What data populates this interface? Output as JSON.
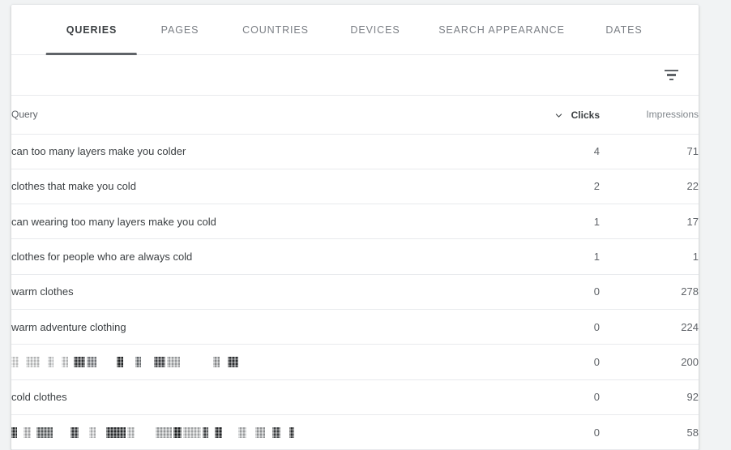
{
  "card": {
    "tabs": [
      {
        "label": "QUERIES",
        "active": true
      },
      {
        "label": "PAGES",
        "active": false
      },
      {
        "label": "COUNTRIES",
        "active": false
      },
      {
        "label": "DEVICES",
        "active": false
      },
      {
        "label": "SEARCH APPEARANCE",
        "active": false
      },
      {
        "label": "DATES",
        "active": false
      }
    ],
    "filter_bar": {
      "icon": "filter-list-icon"
    },
    "table": {
      "columns": [
        {
          "key": "query",
          "label": "Query",
          "align": "left",
          "sorted": false
        },
        {
          "key": "clicks",
          "label": "Clicks",
          "align": "right",
          "sorted": true,
          "sort_direction": "desc",
          "sort_icon": "arrow-downward-icon"
        },
        {
          "key": "impressions",
          "label": "Impressions",
          "align": "right",
          "sorted": false
        }
      ],
      "rows": [
        {
          "query": "can too many layers make you colder",
          "redacted": false,
          "clicks": "4",
          "impressions": "71"
        },
        {
          "query": "clothes that make you cold",
          "redacted": false,
          "clicks": "2",
          "impressions": "22"
        },
        {
          "query": "can wearing too many layers make you cold",
          "redacted": false,
          "clicks": "1",
          "impressions": "17"
        },
        {
          "query": "clothes for people who are always cold",
          "redacted": false,
          "clicks": "1",
          "impressions": "1"
        },
        {
          "query": "warm clothes",
          "redacted": false,
          "clicks": "0",
          "impressions": "278"
        },
        {
          "query": "warm adventure clothing",
          "redacted": false,
          "clicks": "0",
          "impressions": "224"
        },
        {
          "query": "",
          "redacted": true,
          "redaction_pattern": [
            {
              "w": 9,
              "tone": "#eceded"
            },
            {
              "w": 5,
              "tone": "transparent"
            },
            {
              "w": 17,
              "tone": "#e0e2e3"
            },
            {
              "w": 6,
              "tone": "transparent"
            },
            {
              "w": 7,
              "tone": "#d9dbdc"
            },
            {
              "w": 6,
              "tone": "transparent"
            },
            {
              "w": 8,
              "tone": "#dfe1e2"
            },
            {
              "w": 3,
              "tone": "transparent"
            },
            {
              "w": 14,
              "tone": "#3b3e41"
            },
            {
              "w": 12,
              "tone": "#8b8f93"
            },
            {
              "w": 21,
              "tone": "transparent"
            },
            {
              "w": 8,
              "tone": "#26292b"
            },
            {
              "w": 11,
              "tone": "transparent"
            },
            {
              "w": 7,
              "tone": "#7d8185"
            },
            {
              "w": 12,
              "tone": "transparent"
            },
            {
              "w": 14,
              "tone": "#4b4e51"
            },
            {
              "w": 16,
              "tone": "#bdc0c2"
            },
            {
              "w": 37,
              "tone": "transparent"
            },
            {
              "w": 8,
              "tone": "#a8abad"
            },
            {
              "w": 6,
              "tone": "transparent"
            },
            {
              "w": 13,
              "tone": "#373a3d"
            }
          ],
          "clicks": "0",
          "impressions": "200"
        },
        {
          "query": "cold clothes",
          "redacted": false,
          "clicks": "0",
          "impressions": "92"
        },
        {
          "query": "",
          "redacted": true,
          "redaction_pattern": [
            {
              "w": 7,
              "tone": "#2f3234"
            },
            {
              "w": 4,
              "tone": "transparent"
            },
            {
              "w": 9,
              "tone": "#c8cacc"
            },
            {
              "w": 3,
              "tone": "transparent"
            },
            {
              "w": 20,
              "tone": "#6c7073"
            },
            {
              "w": 18,
              "tone": "transparent"
            },
            {
              "w": 10,
              "tone": "#3e4144"
            },
            {
              "w": 9,
              "tone": "transparent"
            },
            {
              "w": 8,
              "tone": "#d2d4d6"
            },
            {
              "w": 9,
              "tone": "transparent"
            },
            {
              "w": 24,
              "tone": "#323538"
            },
            {
              "w": 9,
              "tone": "#cfd1d3"
            },
            {
              "w": 22,
              "tone": "transparent"
            },
            {
              "w": 20,
              "tone": "#b9bcbe"
            },
            {
              "w": 10,
              "tone": "#1f2224"
            },
            {
              "w": 22,
              "tone": "#cacccd"
            },
            {
              "w": 7,
              "tone": "#494c4f"
            },
            {
              "w": 4,
              "tone": "transparent"
            },
            {
              "w": 9,
              "tone": "#2a2d2f"
            },
            {
              "w": 16,
              "tone": "transparent"
            },
            {
              "w": 10,
              "tone": "#c3c5c7"
            },
            {
              "w": 7,
              "tone": "transparent"
            },
            {
              "w": 12,
              "tone": "#b3b6b8"
            },
            {
              "w": 5,
              "tone": "transparent"
            },
            {
              "w": 10,
              "tone": "#4a4d50"
            },
            {
              "w": 7,
              "tone": "transparent"
            },
            {
              "w": 6,
              "tone": "#35383a"
            }
          ],
          "clicks": "0",
          "impressions": "58"
        }
      ]
    }
  },
  "colors": {
    "page_background": "#f1f3f4",
    "card_background": "#ffffff",
    "divider": "#e8eaed",
    "text_primary": "#3c4043",
    "text_secondary": "#5f6368",
    "text_muted": "#80868b",
    "tab_active_indicator": "#5f6368"
  }
}
